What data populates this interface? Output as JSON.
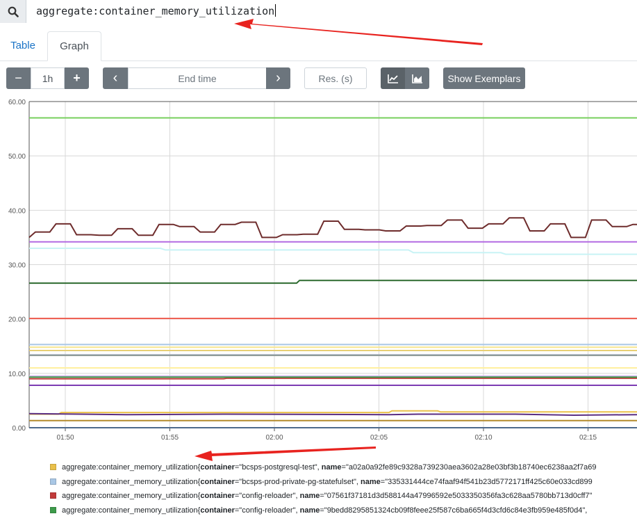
{
  "query": "aggregate:container_memory_utilization",
  "tabs": {
    "table": "Table",
    "graph": "Graph"
  },
  "controls": {
    "range": "1h",
    "end_time_placeholder": "End time",
    "res_placeholder": "Res. (s)",
    "show_exemplars": "Show Exemplars",
    "minus": "−",
    "plus": "+",
    "prev": "‹",
    "next": "›"
  },
  "colors": {
    "annotation_arrow": "#e8231f",
    "button_dark": "#6c757d"
  },
  "chart_data": {
    "type": "line",
    "x_ticks": [
      "01:50",
      "01:55",
      "02:00",
      "02:05",
      "02:10",
      "02:15"
    ],
    "y_ticks": [
      "0.00",
      "10.00",
      "20.00",
      "30.00",
      "40.00",
      "50.00",
      "60.00"
    ],
    "ylim": [
      0,
      60
    ],
    "x_range_minutes": [
      0,
      62.5
    ],
    "grid": true,
    "series": [
      {
        "color": "#77cf5c",
        "points": [
          [
            0,
            57
          ],
          [
            62.5,
            57
          ]
        ]
      },
      {
        "color": "#6e2c2c",
        "points": [
          [
            0,
            35
          ],
          [
            0.3,
            36
          ],
          [
            1,
            36
          ],
          [
            1.3,
            37.5
          ],
          [
            2,
            37.5
          ],
          [
            2.3,
            35.5
          ],
          [
            3,
            35.5
          ],
          [
            3.4,
            35.4
          ],
          [
            4,
            35.4
          ],
          [
            4.3,
            36.6
          ],
          [
            5,
            36.6
          ],
          [
            5.3,
            35.4
          ],
          [
            6,
            35.4
          ],
          [
            6.3,
            37.4
          ],
          [
            7,
            37.4
          ],
          [
            7.3,
            37
          ],
          [
            8,
            37
          ],
          [
            8.3,
            36
          ],
          [
            9,
            36
          ],
          [
            9.3,
            37.4
          ],
          [
            10,
            37.4
          ],
          [
            10.3,
            37.8
          ],
          [
            11,
            37.8
          ],
          [
            11.3,
            35
          ],
          [
            12,
            35
          ],
          [
            12.3,
            35.5
          ],
          [
            13,
            35.5
          ],
          [
            13.3,
            35.6
          ],
          [
            14,
            35.6
          ],
          [
            14.3,
            38
          ],
          [
            15,
            38
          ],
          [
            15.3,
            36.5
          ],
          [
            16,
            36.5
          ],
          [
            16.3,
            36.4
          ],
          [
            17,
            36.4
          ],
          [
            17.3,
            36.2
          ],
          [
            18,
            36.2
          ],
          [
            18.3,
            37.1
          ],
          [
            19,
            37.1
          ],
          [
            19.3,
            37.2
          ],
          [
            20,
            37.2
          ],
          [
            20.3,
            38.2
          ],
          [
            21,
            38.2
          ],
          [
            21.3,
            36.7
          ],
          [
            22,
            36.7
          ],
          [
            22.3,
            37.5
          ],
          [
            23,
            37.5
          ],
          [
            23.3,
            38.6
          ],
          [
            24,
            38.6
          ],
          [
            24.3,
            36.2
          ],
          [
            25,
            36.2
          ],
          [
            25.3,
            37.5
          ],
          [
            26,
            37.5
          ],
          [
            26.3,
            35
          ],
          [
            27,
            35
          ],
          [
            27.3,
            38.2
          ],
          [
            28,
            38.2
          ],
          [
            28.3,
            37
          ],
          [
            29,
            37
          ],
          [
            29.3,
            37.4
          ],
          [
            29.5,
            37.4
          ]
        ]
      },
      {
        "color": "#b36ae2",
        "points": [
          [
            0,
            34.2
          ],
          [
            62.5,
            34.2
          ]
        ]
      },
      {
        "color": "#c8f3f5",
        "points": [
          [
            0,
            33
          ],
          [
            13.5,
            33
          ],
          [
            14,
            32.7
          ],
          [
            39,
            32.7
          ],
          [
            39.5,
            32.2
          ],
          [
            48.5,
            32.2
          ],
          [
            49,
            31.9
          ],
          [
            62.5,
            31.9
          ]
        ]
      },
      {
        "color": "#2c6a2e",
        "points": [
          [
            0,
            26.6
          ],
          [
            27.5,
            26.6
          ],
          [
            27.8,
            27.1
          ],
          [
            62.5,
            27.1
          ]
        ]
      },
      {
        "color": "#ef5b4d",
        "points": [
          [
            0,
            20.1
          ],
          [
            62.5,
            20.1
          ]
        ]
      },
      {
        "color": "#a9c7e5",
        "points": [
          [
            0,
            15.3
          ],
          [
            62.5,
            15.3
          ]
        ]
      },
      {
        "color": "#f6e58d",
        "points": [
          [
            0,
            14.8
          ],
          [
            62.5,
            14.8
          ]
        ]
      },
      {
        "color": "#e7cf74",
        "points": [
          [
            0,
            14.2
          ],
          [
            62.5,
            14.2
          ]
        ]
      },
      {
        "color": "#7e8a7a",
        "points": [
          [
            0,
            13.3
          ],
          [
            62.5,
            13.3
          ]
        ]
      },
      {
        "color": "#9da8b0",
        "points": [
          [
            0,
            13.4
          ],
          [
            62.5,
            13.4
          ]
        ]
      },
      {
        "color": "#fff09e",
        "points": [
          [
            0,
            11
          ],
          [
            62.5,
            11
          ]
        ]
      },
      {
        "color": "#d6b3f0",
        "points": [
          [
            0,
            9.5
          ],
          [
            62.5,
            9.5
          ]
        ]
      },
      {
        "color": "#c23b3b",
        "points": [
          [
            0,
            9
          ],
          [
            20,
            9
          ],
          [
            20.3,
            9.1
          ],
          [
            62.5,
            9.1
          ]
        ]
      },
      {
        "color": "#3d9b4a",
        "points": [
          [
            0,
            9.3
          ],
          [
            62.5,
            9.3
          ]
        ]
      },
      {
        "color": "#7c3bb3",
        "points": [
          [
            0,
            7.8
          ],
          [
            62.5,
            7.8
          ]
        ]
      },
      {
        "color": "#e9c04a",
        "points": [
          [
            0,
            2.5
          ],
          [
            3,
            2.5
          ],
          [
            3.3,
            2.8
          ],
          [
            37,
            2.8
          ],
          [
            37.3,
            3.1
          ],
          [
            42,
            3.1
          ],
          [
            42.3,
            2.9
          ],
          [
            62.5,
            2.9
          ]
        ]
      },
      {
        "color": "#5a2d82",
        "points": [
          [
            0,
            2.6
          ],
          [
            10,
            2.4
          ],
          [
            20,
            2.5
          ],
          [
            37,
            2.4
          ],
          [
            40,
            2.5
          ],
          [
            50,
            2.5
          ],
          [
            56,
            2.3
          ],
          [
            62.5,
            2.4
          ]
        ]
      },
      {
        "color": "#b28a2c",
        "points": [
          [
            0,
            1.3
          ],
          [
            62.5,
            1.3
          ]
        ]
      },
      {
        "color": "#4d6a8c",
        "points": [
          [
            0,
            0
          ],
          [
            62.5,
            0
          ]
        ]
      }
    ]
  },
  "legend": [
    {
      "color": "#e9c04a",
      "metric": "aggregate:container_memory_utilization",
      "open": "{",
      "l1": "container",
      "v1": "=\"bcsps-postgresql-test\", ",
      "l2": "name",
      "v2": "=\"a02a0a92fe89c9328a739230aea3602a28e03bf3b18740ec6238aa2f7a69"
    },
    {
      "color": "#a9c7e5",
      "metric": "aggregate:container_memory_utilization",
      "open": "{",
      "l1": "container",
      "v1": "=\"bcsps-prod-private-pg-statefulset\", ",
      "l2": "name",
      "v2": "=\"335331444ce74faaf94f541b23d5772171ff425c60e033cd899"
    },
    {
      "color": "#c23b3b",
      "metric": "aggregate:container_memory_utilization",
      "open": "{",
      "l1": "container",
      "v1": "=\"config-reloader\", ",
      "l2": "name",
      "v2": "=\"07561f37181d3d588144a47996592e5033350356fa3c628aa5780bb713d0cff7\""
    },
    {
      "color": "#3d9b4a",
      "metric": "aggregate:container_memory_utilization",
      "open": "{",
      "l1": "container",
      "v1": "=\"config-reloader\", ",
      "l2": "name",
      "v2": "=\"9bedd8295851324cb09f8feee25f587c6ba665f4d3cfd6c84e3fb959e485f0d4\", "
    }
  ]
}
